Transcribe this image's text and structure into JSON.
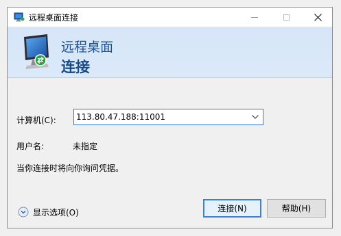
{
  "window": {
    "title": "远程桌面连接",
    "title_icon": "remote-desktop-icon",
    "controls": [
      "minimize",
      "maximize",
      "close"
    ]
  },
  "banner": {
    "line1": "远程桌面",
    "line2": "连接",
    "icon": "remote-desktop-monitor-icon"
  },
  "form": {
    "computer_label": "计算机(C):",
    "computer_value": "113.80.47.188:11001",
    "username_label": "用户名:",
    "username_value": "未指定",
    "note": "当你连接时将向你询问凭据。"
  },
  "footer": {
    "show_options": "显示选项(O)",
    "connect_button": "连接(N)",
    "help_button": "帮助(H)"
  },
  "colors": {
    "banner_bg": "#d6e6f8",
    "banner_text": "#1d4f8c",
    "focus_border": "#2b79d0",
    "window_bg": "#f0f0f0"
  }
}
